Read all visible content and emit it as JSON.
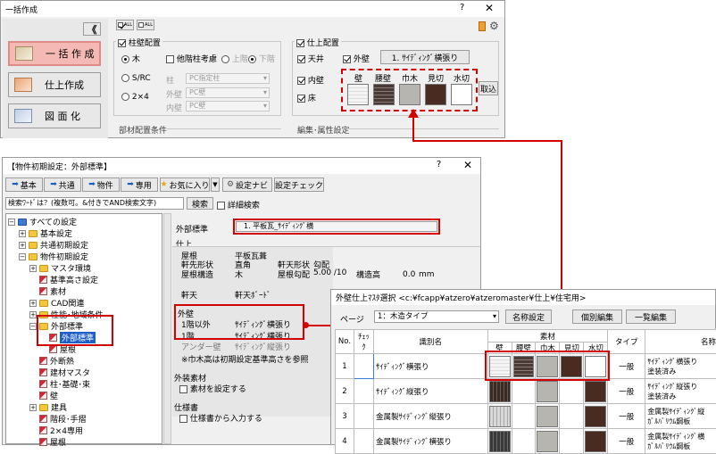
{
  "w1": {
    "title": "一括作成",
    "q": "?",
    "close": "✕",
    "side": {
      "b1": "一 括 作 成",
      "b2": "仕上作成",
      "b3": "図 面 化",
      "collapse": "《"
    },
    "sel_all": "ALL",
    "sel_none": "ALL",
    "pillar": {
      "title": "柱壁配置",
      "wood": "木",
      "other": "他階柱考慮",
      "upper": "上階",
      "lower": "下階",
      "src": "S/RC",
      "pillar_l": "柱",
      "pillar_v": "PC指定柱",
      "x24": "2×4",
      "out_l": "外壁",
      "out_v": "PC壁",
      "in_l": "内壁",
      "in_v": "PC壁"
    },
    "buzai": "部材配置条件",
    "finish": {
      "title": "仕上配置",
      "ceil": "天井",
      "outwall": "外壁",
      "outwall_btn": "1. ｻｲﾃﾞｨﾝｸﾞ横張り",
      "inwall": "内壁",
      "floor": "床",
      "heads": [
        "壁",
        "腰壁",
        "巾木",
        "見切",
        "水切"
      ],
      "take": "取込"
    },
    "edit": "編集･属性設定"
  },
  "w2": {
    "title": "【物件初期設定：外部標準】",
    "q": "?",
    "close": "✕",
    "tb": {
      "basic": "基本",
      "common": "共通",
      "bukken": "物件",
      "dedicated": "専用",
      "fav": "お気に入り",
      "navi": "設定ナビ",
      "check": "設定チェック"
    },
    "search_ph": "検索ﾜｰﾄﾞは？(複数可。&付きでAND検索文字)",
    "search_btn": "検索",
    "detail": "詳細検索",
    "tree": [
      "すべての設定",
      "基本設定",
      "共通初期設定",
      "物件初期設定",
      "マスタ環境",
      "基準高さ設定",
      "素材",
      "CAD関連",
      "性能･地域条件",
      "外部標準",
      "外部標準",
      "屋根",
      "外断熱",
      "建材マスタ",
      "柱･基礎･束",
      "壁",
      "建具",
      "階段･手摺",
      "2×4専用",
      "屋根"
    ],
    "std_l": "外部標準",
    "std_v": "1. 平板瓦_ｻｲﾃﾞｨﾝｸﾞ横",
    "shiage": "仕上",
    "roof": {
      "a": "屋根",
      "a1": "平板瓦葺",
      "b": "軒先形状",
      "b1": "直角",
      "b2": "軒天形状",
      "b3": "勾配",
      "c": "屋根構造",
      "c1": "木",
      "c2": "屋根勾配",
      "c3": "5.00 /10",
      "c4": "構造高",
      "c5": "0.0",
      "c6": "mm"
    },
    "soffit": "軒天",
    "soffit_v": "軒天ﾎﾞｰﾄﾞ",
    "ext": {
      "t": "外壁",
      "r1": "1階以外",
      "r1v": "ｻｲﾃﾞｨﾝｸﾞ横張り",
      "r2": "1階",
      "r2v": "ｻｲﾃﾞｨﾝｸﾞ横張り",
      "r3": "アンダー壁",
      "r3v": "ｻｲﾃﾞｨﾝｸﾞ縦張り"
    },
    "note": "※巾木高は初期設定基準高さを参照",
    "outmat": "外装素材",
    "outmat_chk": "素材を設定する",
    "spec": "仕様書",
    "spec_chk": "仕様書から入力する"
  },
  "w3": {
    "title": "外壁仕上ﾏｽﾀ選択 <c:¥fcapp¥atzero¥atzeromaster¥仕上¥住宅用>",
    "page_l": "ページ",
    "page_v": "1：木造タイプ",
    "name_btn": "名称設定",
    "indiv": "個別編集",
    "list": "一覧編集",
    "heads": {
      "no": "No.",
      "chk": "ﾁｪｯｸ",
      "name": "識別名",
      "mat": "素材",
      "cols": [
        "壁",
        "腰壁",
        "巾木",
        "見切",
        "水切"
      ],
      "type": "タイプ",
      "nm": "名称"
    },
    "rows": [
      {
        "no": "1",
        "name": "ｻｲﾃﾞｨﾝｸﾞ横張り",
        "type": "一般",
        "n1": "ｻｲﾃﾞｨﾝｸﾞ横張り",
        "n2": "塗装済み"
      },
      {
        "no": "2",
        "name": "ｻｲﾃﾞｨﾝｸﾞ縦張り",
        "type": "一般",
        "n1": "ｻｲﾃﾞｨﾝｸﾞ縦張り",
        "n2": "塗装済み"
      },
      {
        "no": "3",
        "name": "金属製ｻｲﾃﾞｨﾝｸﾞ縦張り",
        "type": "一般",
        "n1": "金属製ｻｲﾃﾞｨﾝｸﾞ縦",
        "n2": "ｶﾞﾙﾊﾞﾘｳﾑ鋼板"
      },
      {
        "no": "4",
        "name": "金属製ｻｲﾃﾞｨﾝｸﾞ横張り",
        "type": "一般",
        "n1": "金属製ｻｲﾃﾞｨﾝｸﾞ横",
        "n2": "ｶﾞﾙﾊﾞﾘｳﾑ鋼板"
      }
    ]
  }
}
